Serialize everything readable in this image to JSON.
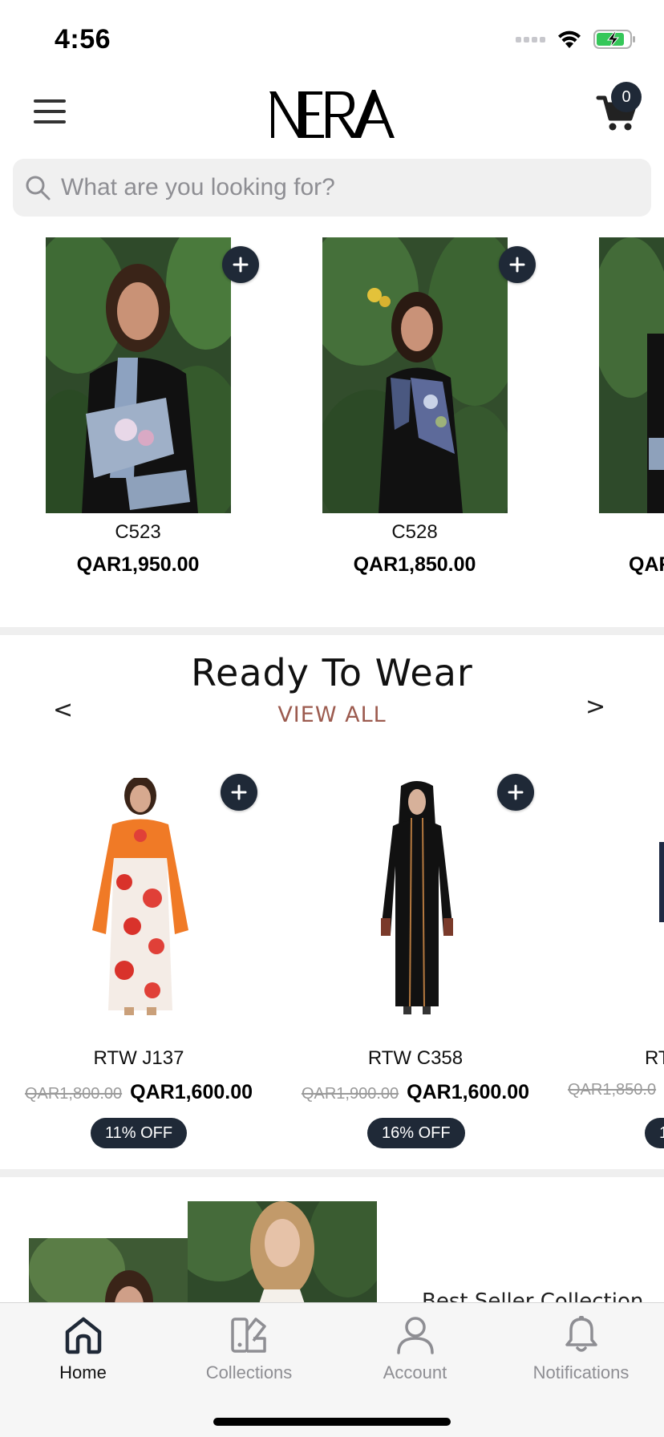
{
  "status_bar": {
    "time": "4:56",
    "signal_icon": "signal-dots-icon",
    "wifi_icon": "wifi-icon",
    "battery_icon": "battery-charging-icon"
  },
  "header": {
    "logo_text": "NERA",
    "cart_count": "0",
    "menu_icon": "hamburger-icon",
    "cart_icon": "cart-icon"
  },
  "search": {
    "placeholder": "What are you looking for?"
  },
  "featured_products": [
    {
      "name": "C523",
      "price": "QAR1,950.00"
    },
    {
      "name": "C528",
      "price": "QAR1,850.00"
    },
    {
      "name": "",
      "price": "QAR"
    }
  ],
  "ready_to_wear": {
    "title": "Ready To Wear",
    "view_all": "VIEW ALL",
    "prev_arrow": "<",
    "next_arrow": ">",
    "products": [
      {
        "name": "RTW J137",
        "old_price": "QAR1,800.00",
        "price": "QAR1,600.00",
        "discount": "11% OFF"
      },
      {
        "name": "RTW C358",
        "old_price": "QAR1,900.00",
        "price": "QAR1,600.00",
        "discount": "16% OFF"
      },
      {
        "name": "RT",
        "old_price": "QAR1,850.0",
        "price": "",
        "discount": "1"
      }
    ]
  },
  "best_seller": {
    "title": "Best Seller Collection"
  },
  "tabbar": {
    "items": [
      {
        "label": "Home",
        "icon": "home-icon",
        "active": true
      },
      {
        "label": "Collections",
        "icon": "collections-icon",
        "active": false
      },
      {
        "label": "Account",
        "icon": "account-icon",
        "active": false
      },
      {
        "label": "Notifications",
        "icon": "bell-icon",
        "active": false
      }
    ]
  },
  "colors": {
    "accent_dark": "#1f2937",
    "view_all": "#9c5b4f",
    "inactive_tab": "#8e8e93"
  }
}
